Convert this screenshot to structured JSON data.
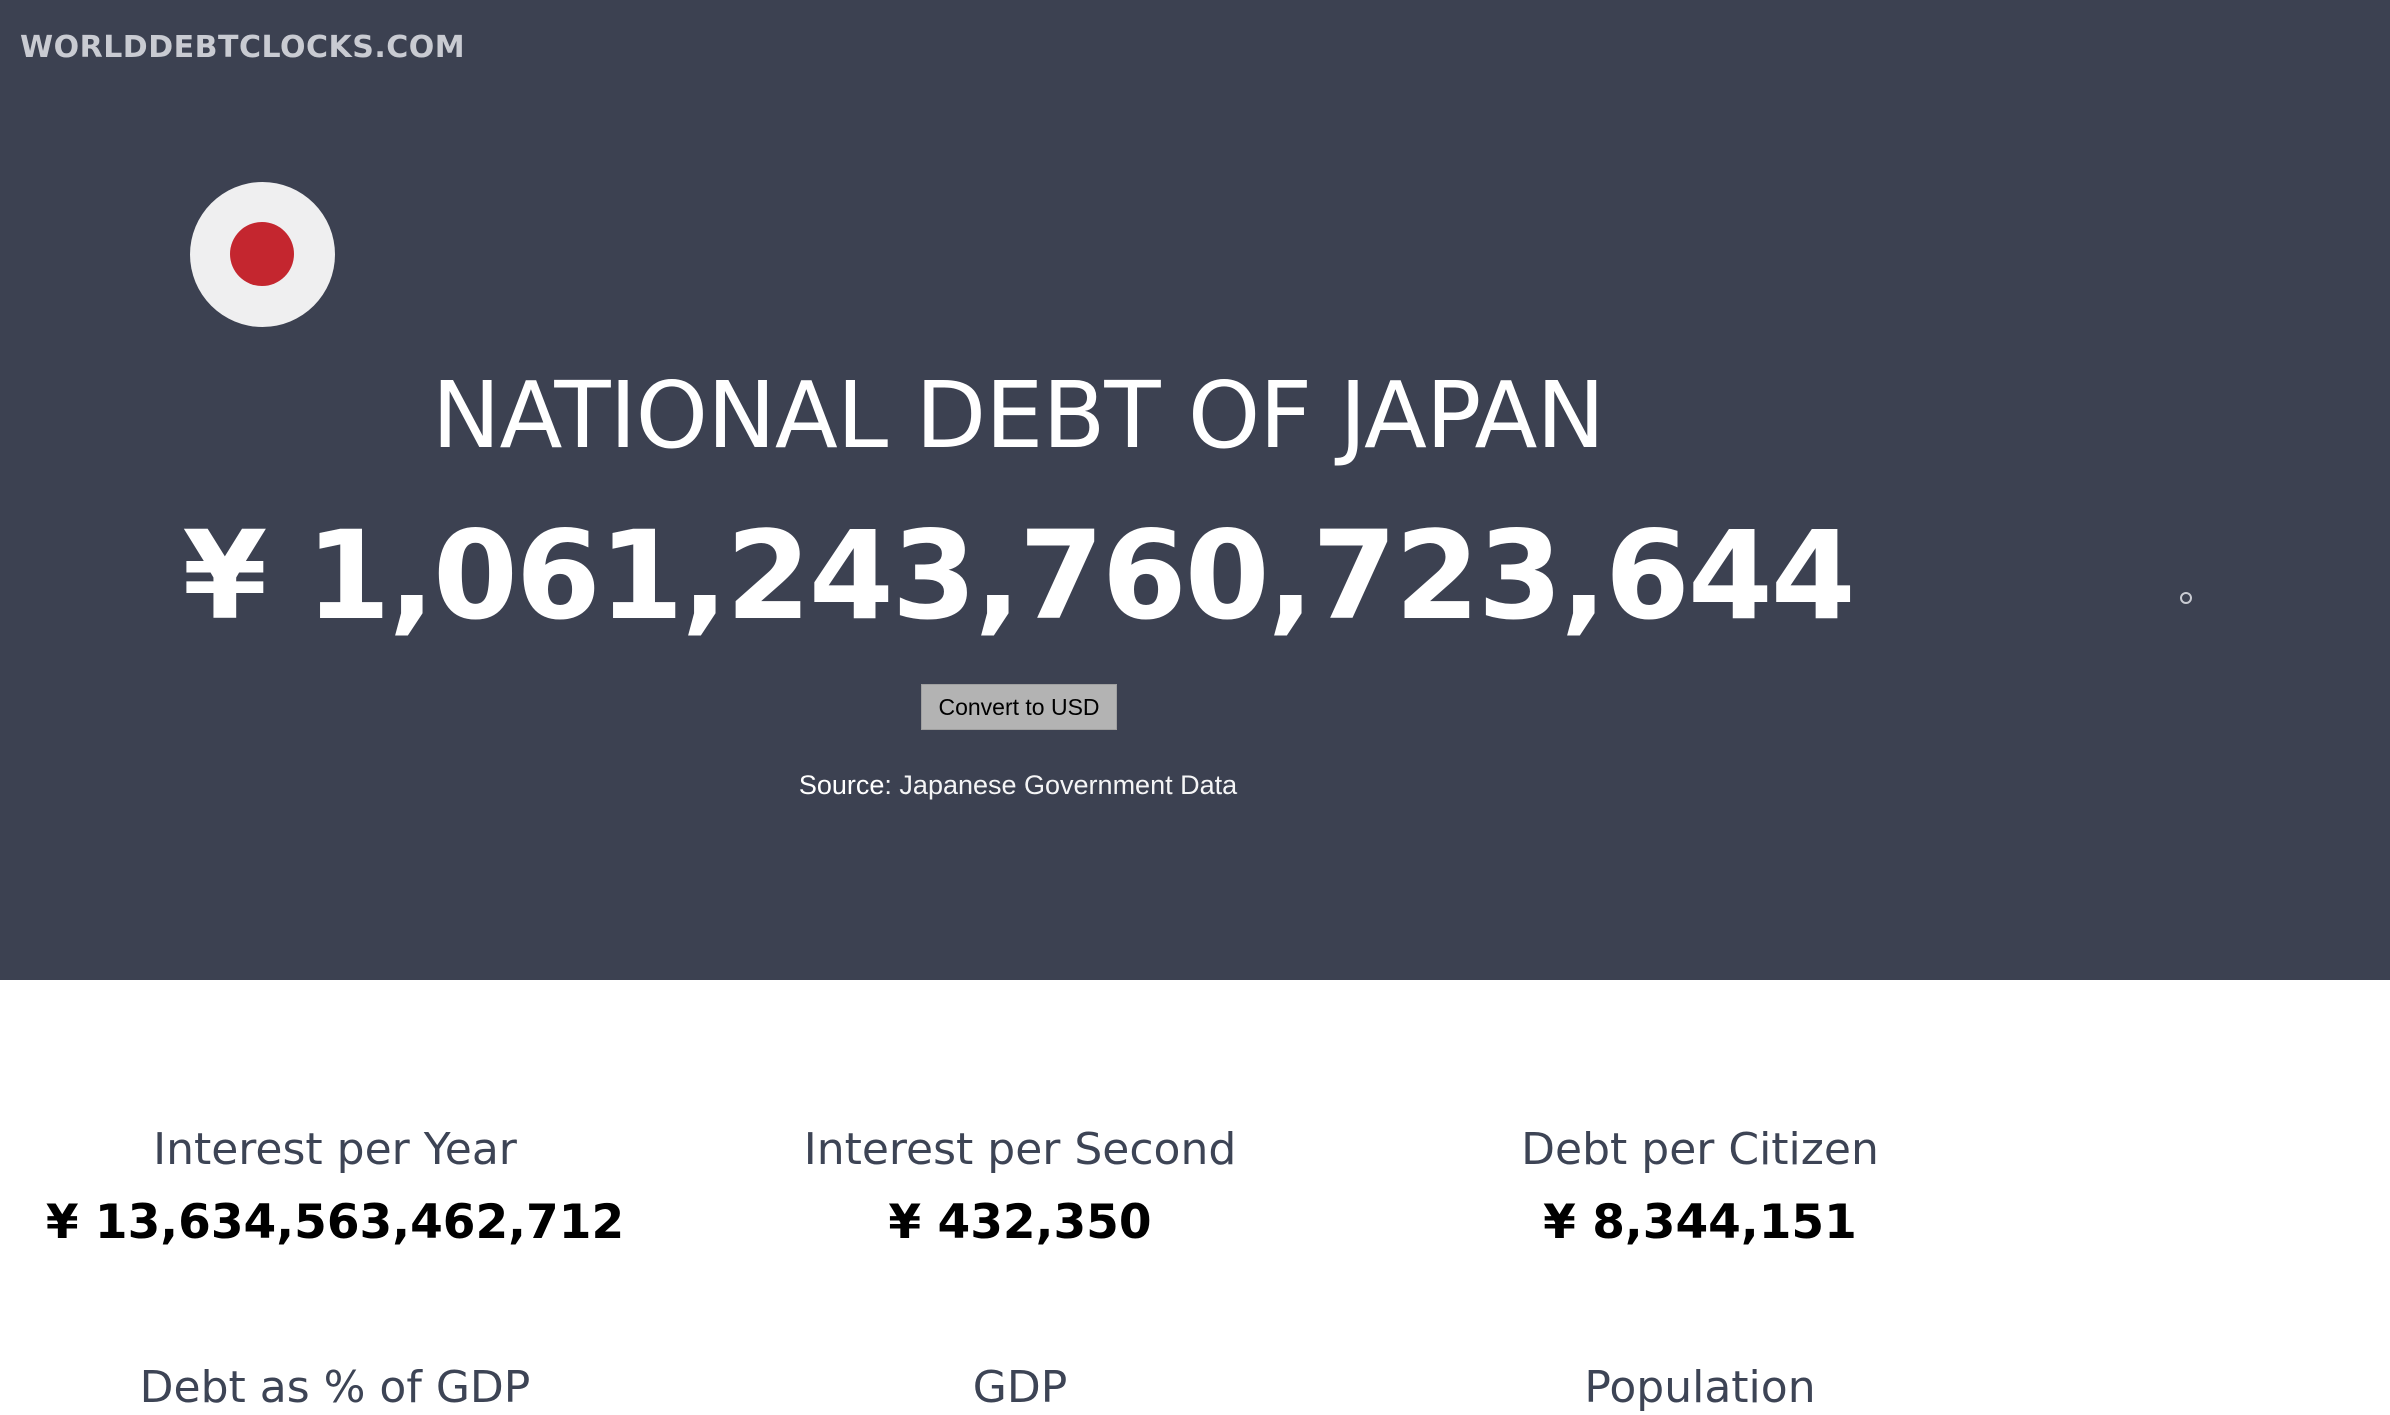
{
  "site": {
    "logo": "WORLDDEBTCLOCKS.COM"
  },
  "hero": {
    "title": "NATIONAL DEBT OF JAPAN",
    "debt": "¥ 1,061,243,760,723,644",
    "convert_label": "Convert to USD",
    "source_label": "Source",
    "source_text": ": Japanese Government Data"
  },
  "stats": [
    {
      "label": "Interest per Year",
      "value": "¥ 13,634,563,462,712"
    },
    {
      "label": "Interest per Second",
      "value": "¥ 432,350"
    },
    {
      "label": "Debt per Citizen",
      "value": "¥ 8,344,151"
    },
    {
      "label": "Debt as % of GDP",
      "value": ""
    },
    {
      "label": "GDP",
      "value": ""
    },
    {
      "label": "Population",
      "value": ""
    }
  ],
  "colors": {
    "hero_bg": "#3c4151",
    "flag_red": "#c4262f",
    "flag_white": "#efeff0"
  },
  "icons": {
    "flag": "japan-flag-icon"
  }
}
